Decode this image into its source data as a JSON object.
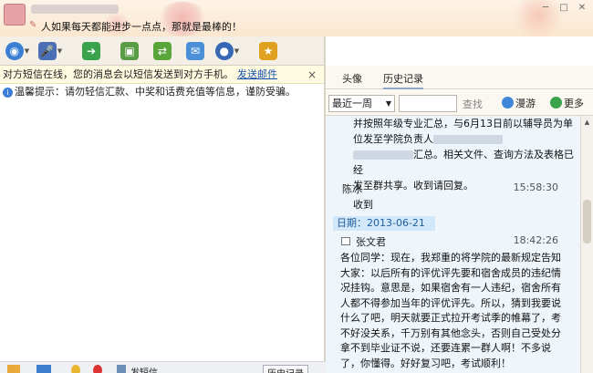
{
  "header": {
    "signature": "人如果每天都能进步一点点，那就是最棒的！",
    "controls": [
      "─",
      "□",
      "✕"
    ]
  },
  "notice": {
    "text": "对方短信在线，您的消息会以短信发送到对方手机。",
    "link": "发送邮件",
    "close": "×"
  },
  "tip": {
    "icon": "i",
    "text": "温馨提示：请勿轻信汇款、中奖和话费充值等信息，谨防受骗。"
  },
  "bottom_bar": {
    "sms_label": "发短信",
    "history_label": "历史记录"
  },
  "right_tabs": [
    "头像",
    "历史记录"
  ],
  "history_toolbar": {
    "range": "最近一周",
    "search": "查找",
    "roam": "漫游",
    "more": "更多"
  },
  "history": {
    "message1": {
      "lines": [
        "并按照年级专业汇总，与6月13日前以辅导员为单",
        "位发至学院负责人",
        "汇总。相关文件、查询方法及表格已经",
        "发至群共享。收到请回复。"
      ],
      "line2_prefix": "位发至学院负责人",
      "line3_suffix": "汇总。相关文件、查询方法及表格已经"
    },
    "message2": {
      "sender": "陈冰",
      "time": "15:58:30",
      "text": "收到"
    },
    "date_label": "日期：2013-06-21",
    "message3": {
      "sender": "张文君",
      "time": "18:42:26",
      "lines": [
        "各位同学：现在，我郑重的将学院的最新规定告知",
        "大家：以后所有的评优评先要和宿舍成员的违纪情",
        "况挂钩。意思是，如果宿舍有一人违纪，宿舍所有",
        "人都不得参加当年的评优评先。所以，猜到我要说",
        "什么了吧，明天就要正式拉开考试季的帷幕了，考",
        "不好没关系，千万别有其他念头，否则自己受处分",
        "拿不到毕业证不说，还要连累一群人啊！不多说",
        "了，你懂得。好好复习吧，考试顺利！"
      ]
    }
  }
}
